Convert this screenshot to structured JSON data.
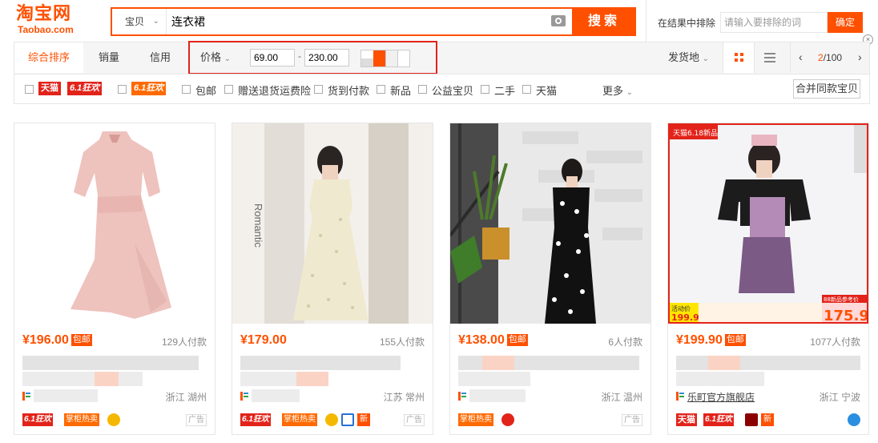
{
  "logo": {
    "cn": "淘宝网",
    "en": "Taobao.com"
  },
  "search": {
    "category": "宝贝",
    "query": "连衣裙",
    "button": "搜索"
  },
  "exclude": {
    "label": "在结果中排除",
    "placeholder": "请输入要排除的词",
    "button": "确定"
  },
  "close_icon": "×",
  "sort": {
    "tabs": [
      "综合排序",
      "销量",
      "信用"
    ],
    "price_label": "价格",
    "price_min": "69.00",
    "price_dash": "-",
    "price_max": "230.00",
    "ship_from": "发货地",
    "page_current": "2",
    "page_total": "/100"
  },
  "filters": {
    "tmall_badge": "天猫",
    "promo_61": "6.1狂欢",
    "items": [
      "包邮",
      "赠送退货运费险",
      "货到付款",
      "新品",
      "公益宝贝",
      "二手",
      "天猫"
    ],
    "more": "更多",
    "merge": "合并同款宝贝"
  },
  "products": [
    {
      "price": "¥196.00",
      "baoyou": "包邮",
      "sales": "129人付款",
      "shop": "",
      "location": "浙江 湖州",
      "ad": "广告"
    },
    {
      "price": "¥179.00",
      "baoyou": "",
      "sales": "155人付款",
      "shop": "",
      "location": "江苏 常州",
      "ad": "广告"
    },
    {
      "price": "¥138.00",
      "baoyou": "包邮",
      "sales": "6人付款",
      "shop": "",
      "location": "浙江 温州",
      "ad": "广告"
    },
    {
      "price": "¥199.90",
      "baoyou": "包邮",
      "sales": "1077人付款",
      "shop": "乐町官方旗舰店",
      "location": "浙江 宁波",
      "ad": ""
    }
  ],
  "tags": {
    "tmall": "天猫",
    "s61": "6.1狂欢",
    "zhanggui": "掌柜热卖",
    "xin": "新"
  },
  "card4_overlay": {
    "top_label": "天猫6.18新品",
    "activity": "活动价",
    "activity_price": "199.9",
    "big_price": "175.9",
    "refer": "88新品参考价"
  },
  "card2_text": "Romantic",
  "colors": {
    "accent": "#ff5000",
    "highlight": "#e2231a"
  }
}
